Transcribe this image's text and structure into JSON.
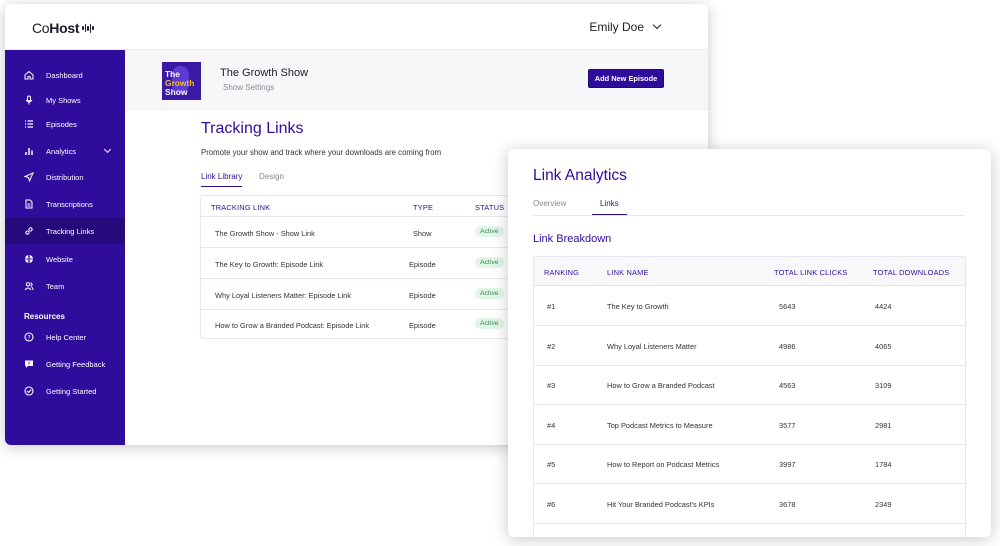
{
  "app": {
    "logo_prefix": "Co",
    "logo_bold": "Host",
    "user_name": "Emily Doe"
  },
  "sidebar": {
    "items": [
      {
        "label": "Dashboard",
        "icon": "home-icon"
      },
      {
        "label": "My Shows",
        "icon": "mic-icon"
      },
      {
        "label": "Episodes",
        "icon": "list-icon"
      },
      {
        "label": "Analytics",
        "icon": "bar-chart-icon"
      },
      {
        "label": "Distribution",
        "icon": "send-icon"
      },
      {
        "label": "Transcriptions",
        "icon": "document-icon"
      },
      {
        "label": "Tracking Links",
        "icon": "link-icon"
      },
      {
        "label": "Website",
        "icon": "globe-icon"
      },
      {
        "label": "Team",
        "icon": "team-icon"
      }
    ],
    "resources_heading": "Resources",
    "resources": [
      {
        "label": "Help Center",
        "icon": "help-icon"
      },
      {
        "label": "Getting Feedback",
        "icon": "chat-icon"
      },
      {
        "label": "Getting Started",
        "icon": "check-circle-icon"
      }
    ]
  },
  "show": {
    "cover_lines": [
      "The",
      "Growth",
      "Show"
    ],
    "name": "The Growth Show",
    "settings_link": "Show Settings",
    "add_button": "Add New Episode"
  },
  "tracking": {
    "title": "Tracking Links",
    "description": "Promote your show and track where your downloads are coming from",
    "tabs": [
      "Link Library",
      "Design"
    ],
    "columns": [
      "TRACKING LINK",
      "TYPE",
      "STATUS"
    ],
    "rows": [
      {
        "link": "The Growth Show - Show Link",
        "type": "Show",
        "status": "Active"
      },
      {
        "link": "The Key to Growth: Episode Link",
        "type": "Episode",
        "status": "Active"
      },
      {
        "link": "Why Loyal Listeners Matter: Episode Link",
        "type": "Episode",
        "status": "Active"
      },
      {
        "link": "How to Grow a Branded Podcast: Episode Link",
        "type": "Episode",
        "status": "Active"
      }
    ]
  },
  "analytics": {
    "title": "Link Analytics",
    "tabs": [
      "Overview",
      "Links"
    ],
    "breakdown_title": "Link Breakdown",
    "columns": [
      "RANKING",
      "LINK NAME",
      "TOTAL LINK CLICKS",
      "TOTAL DOWNLOADS"
    ],
    "rows": [
      {
        "rank": "#1",
        "name": "The Key to Growth",
        "clicks": "5643",
        "downloads": "4424"
      },
      {
        "rank": "#2",
        "name": "Why Loyal Listeners Matter",
        "clicks": "4986",
        "downloads": "4065"
      },
      {
        "rank": "#3",
        "name": "How to Grow a Branded Podcast",
        "clicks": "4563",
        "downloads": "3109"
      },
      {
        "rank": "#4",
        "name": "Top Podcast Metrics to Measure",
        "clicks": "3577",
        "downloads": "2981"
      },
      {
        "rank": "#5",
        "name": "How to Report on Podcast Metrics",
        "clicks": "3997",
        "downloads": "1784"
      },
      {
        "rank": "#6",
        "name": "Hit Your Branded Podcast's KPIs",
        "clicks": "3678",
        "downloads": "2349"
      }
    ]
  },
  "colors": {
    "brand": "#2f0c9c",
    "active_badge": "#2d8a4c"
  }
}
